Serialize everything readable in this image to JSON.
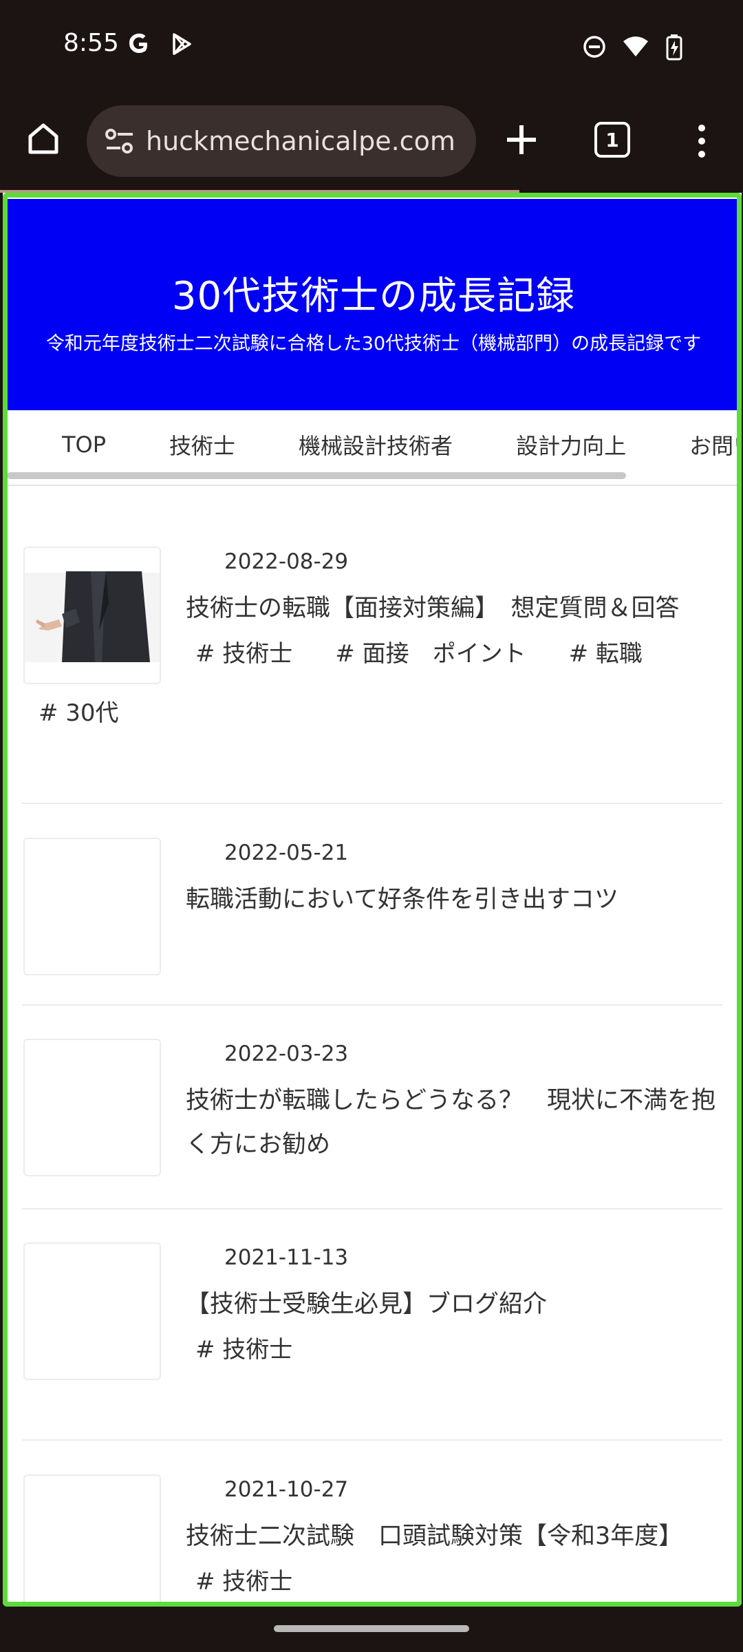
{
  "status": {
    "time": "8:55"
  },
  "browser": {
    "url": "huckmechanicalpe.com",
    "tab_count": "1"
  },
  "site": {
    "title": "30代技術士の成長記録",
    "subtitle": "令和元年度技術士二次試験に合格した30代技術士（機械部門）の成長記録です",
    "header_color": "#0000f5"
  },
  "nav": {
    "items": [
      "TOP",
      "技術士",
      "機械設計技術者",
      "設計力向上",
      "お問い"
    ]
  },
  "posts": [
    {
      "date": "2022-08-29",
      "title": "技術士の転職【面接対策編】　想定質問＆回答",
      "tags": [
        "# 技術士",
        "# 面接　ポイント",
        "# 転職"
      ],
      "tags2": [
        "# 30代"
      ]
    },
    {
      "date": "2022-05-21",
      "title": "転職活動において好条件を引き出すコツ",
      "tags": []
    },
    {
      "date": "2022-03-23",
      "title": "技術士が転職したらどうなる？　現状に不満を抱く方にお勧め",
      "tags": []
    },
    {
      "date": "2021-11-13",
      "title": "【技術士受験生必見】ブログ紹介",
      "tags": [
        "# 技術士"
      ]
    },
    {
      "date": "2021-10-27",
      "title": "技術士二次試験　口頭試験対策【令和3年度】",
      "tags": [
        "# 技術士"
      ]
    }
  ]
}
